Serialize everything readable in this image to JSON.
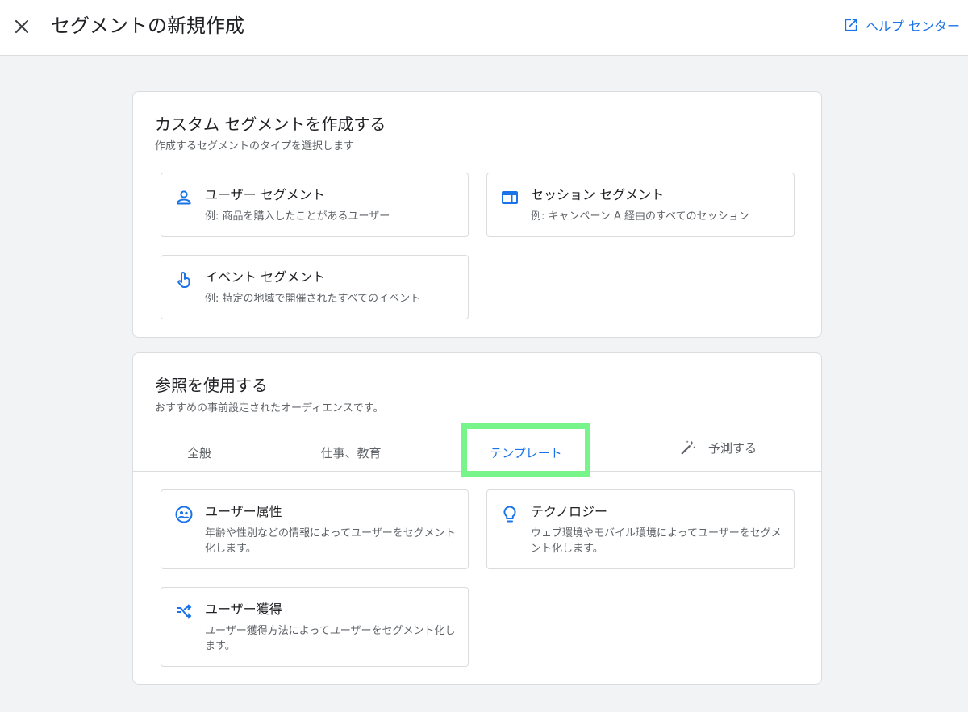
{
  "header": {
    "title": "セグメントの新規作成",
    "help_label": "ヘルプ センター",
    "close_icon": "close-icon",
    "help_icon": "open-in-new-icon"
  },
  "custom_segment": {
    "title": "カスタム セグメントを作成する",
    "subtitle": "作成するセグメントのタイプを選択します",
    "tiles": [
      {
        "title": "ユーザー セグメント",
        "desc": "例: 商品を購入したことがあるユーザー",
        "icon": "person-icon"
      },
      {
        "title": "セッション セグメント",
        "desc": "例: キャンペーン A 経由のすべてのセッション",
        "icon": "web-session-icon"
      },
      {
        "title": "イベント セグメント",
        "desc": "例: 特定の地域で開催されたすべてのイベント",
        "icon": "touch-icon"
      }
    ]
  },
  "reference": {
    "title": "参照を使用する",
    "subtitle": "おすすめの事前設定されたオーディエンスです。",
    "tabs": [
      {
        "label": "全般"
      },
      {
        "label": "仕事、教育"
      },
      {
        "label": "テンプレート",
        "active": true
      },
      {
        "label": "予測する",
        "icon": "magic-wand-icon"
      }
    ],
    "tiles": [
      {
        "title": "ユーザー属性",
        "desc": "年齢や性別などの情報によってユーザーをセグメント化します。",
        "icon": "demographics-icon"
      },
      {
        "title": "テクノロジー",
        "desc": "ウェブ環境やモバイル環境によってユーザーをセグメント化します。",
        "icon": "lightbulb-icon"
      },
      {
        "title": "ユーザー獲得",
        "desc": "ユーザー獲得方法によってユーザーをセグメント化します。",
        "icon": "shuffle-icon"
      }
    ]
  },
  "colors": {
    "accent": "#1a73e8",
    "highlight": "#78f58a",
    "background": "#f1f3f4"
  }
}
